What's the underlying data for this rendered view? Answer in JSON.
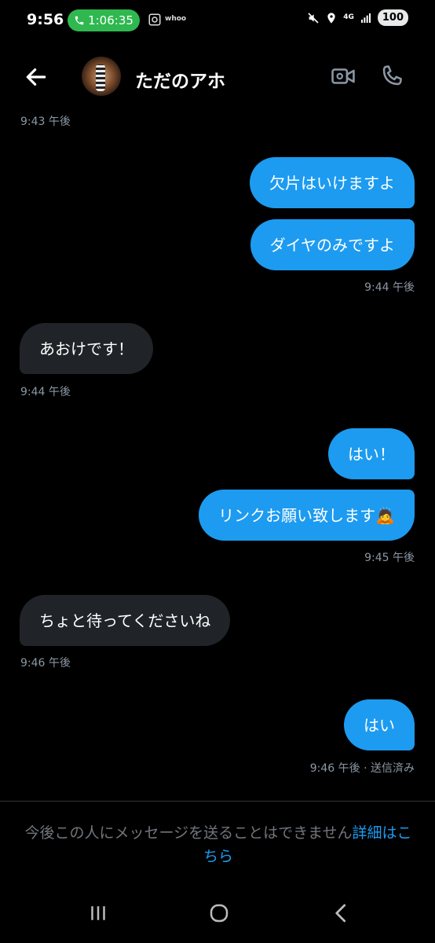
{
  "status_bar": {
    "time": "9:56",
    "call_duration": "1:06:35",
    "app_label": "whoo",
    "network": "4G",
    "battery": "100"
  },
  "header": {
    "contact_name": "ただのアホ"
  },
  "messages": [
    {
      "type": "timestamp",
      "side": "left",
      "text": "9:43 午後"
    },
    {
      "type": "sent",
      "text": "欠片はいけますよ"
    },
    {
      "type": "sent",
      "text": "ダイヤのみですよ"
    },
    {
      "type": "timestamp",
      "side": "right",
      "text": "9:44 午後"
    },
    {
      "type": "received",
      "text": "あおけです！"
    },
    {
      "type": "timestamp",
      "side": "left",
      "text": "9:44 午後"
    },
    {
      "type": "sent",
      "text": "はい！"
    },
    {
      "type": "sent",
      "text": "リンクお願い致します🙇"
    },
    {
      "type": "timestamp",
      "side": "right",
      "text": "9:45 午後"
    },
    {
      "type": "received",
      "text": "ちょと待ってくださいね"
    },
    {
      "type": "timestamp",
      "side": "left",
      "text": "9:46 午後"
    },
    {
      "type": "sent",
      "text": "はい"
    },
    {
      "type": "timestamp",
      "side": "right",
      "text": "9:46 午後 · 送信済み"
    }
  ],
  "footer": {
    "notice_text": "今後この人にメッセージを送ることはできません",
    "notice_link": "詳細はこちら"
  },
  "colors": {
    "accent": "#1d9bf0",
    "received_bubble": "#202327",
    "timestamp": "#8b98a5"
  }
}
